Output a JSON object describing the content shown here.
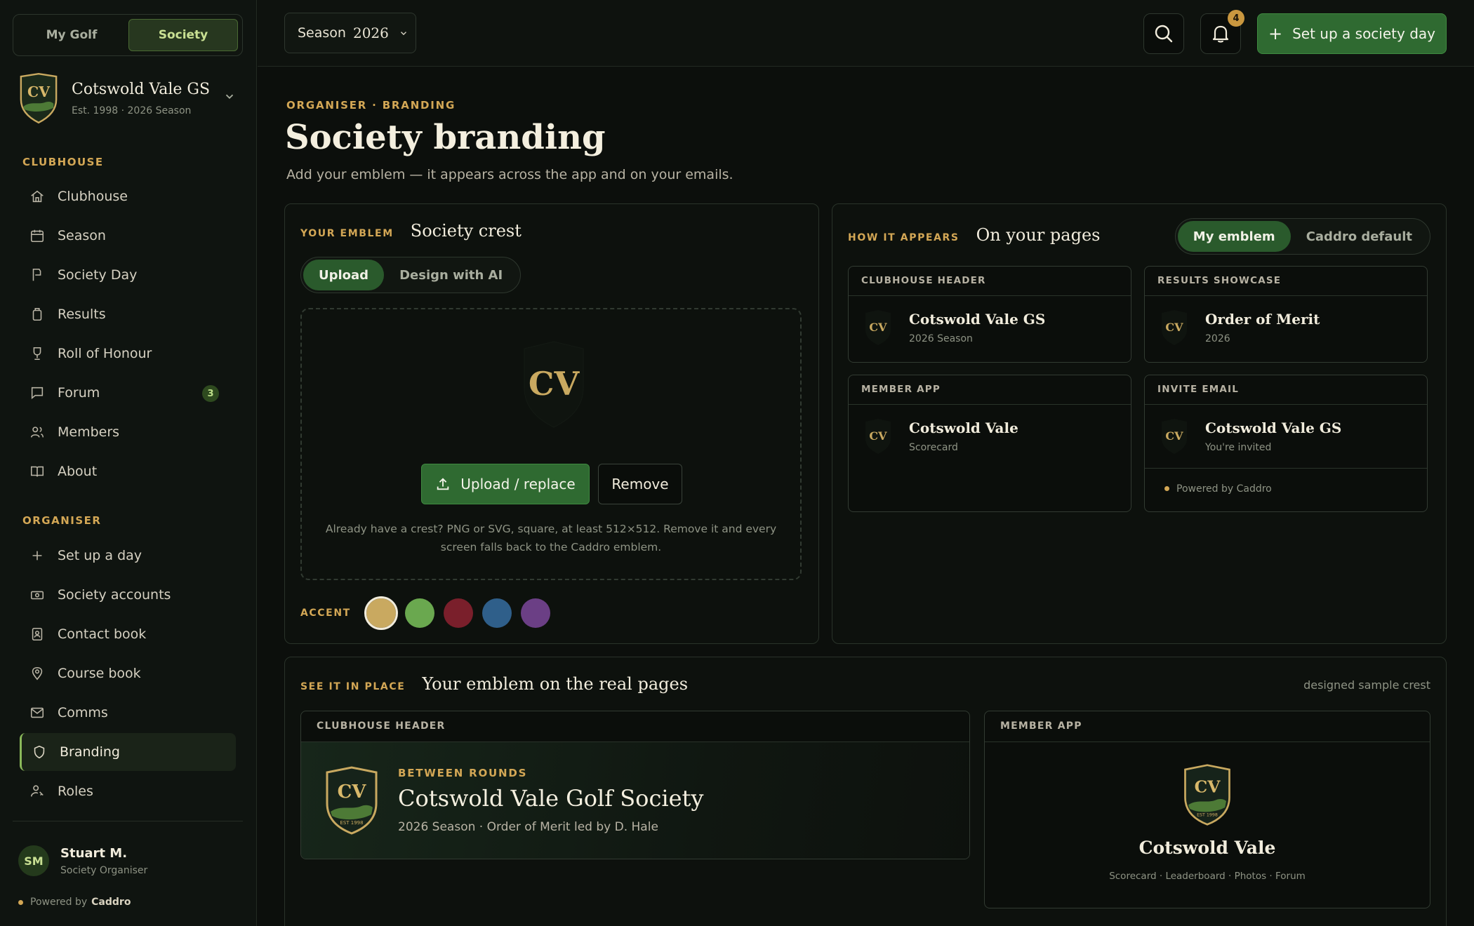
{
  "sidebar": {
    "mode_tabs": [
      "My Golf",
      "Society"
    ],
    "active_mode": "Society",
    "society": {
      "crest_initials": "CV",
      "crest_motto": "EST 1998",
      "name": "Cotswold Vale GS",
      "sub": "Est. 1998 · 2026 Season"
    },
    "sections": {
      "clubhouse": "CLUBHOUSE",
      "organiser": "ORGANISER"
    },
    "clubhouse_items": [
      {
        "label": "Clubhouse",
        "icon": "home-icon"
      },
      {
        "label": "Season",
        "icon": "calendar-icon"
      },
      {
        "label": "Society Day",
        "icon": "flag-icon"
      },
      {
        "label": "Results",
        "icon": "clipboard-icon"
      },
      {
        "label": "Roll of Honour",
        "icon": "trophy-icon"
      },
      {
        "label": "Forum",
        "icon": "chat-icon",
        "badge": "3"
      },
      {
        "label": "Members",
        "icon": "people-icon"
      },
      {
        "label": "About",
        "icon": "book-icon"
      }
    ],
    "organiser_items": [
      {
        "label": "Set up a day",
        "icon": "plus-icon"
      },
      {
        "label": "Society accounts",
        "icon": "money-icon"
      },
      {
        "label": "Contact book",
        "icon": "contact-icon"
      },
      {
        "label": "Course book",
        "icon": "location-pin-icon"
      },
      {
        "label": "Comms",
        "icon": "mail-icon"
      },
      {
        "label": "Branding",
        "icon": "shield-icon",
        "active": true
      },
      {
        "label": "Roles",
        "icon": "user-key-icon"
      }
    ],
    "user": {
      "initials": "SM",
      "name": "Stuart M.",
      "role": "Society Organiser"
    },
    "powered_prefix": "Powered by",
    "powered_brand": "Caddro"
  },
  "topbar": {
    "season_label": "Season",
    "season_year": "2026",
    "notification_count": "4",
    "primary_action": "Set up a society day"
  },
  "page": {
    "eyebrow": "ORGANISER · BRANDING",
    "title": "Society branding",
    "subtitle": "Add your emblem — it appears across the app and on your emails."
  },
  "emblem_panel": {
    "label": "YOUR EMBLEM",
    "heading": "Society crest",
    "tabs": [
      "Upload",
      "Design with AI"
    ],
    "active_tab": "Upload",
    "upload_button": "Upload / replace",
    "remove_button": "Remove",
    "help_text": "Already have a crest? PNG or SVG, square, at least 512×512. Remove it and every screen falls back to the Caddro emblem.",
    "accent_label": "ACCENT",
    "accent_colors": [
      "#c9a960",
      "#6aa84f",
      "#7a1f2b",
      "#2f5f8a",
      "#6b3f85"
    ],
    "accent_selected": "#c9a960"
  },
  "appears_panel": {
    "label": "HOW IT APPEARS",
    "heading": "On your pages",
    "toggle": [
      "My emblem",
      "Caddro default"
    ],
    "active_toggle": "My emblem",
    "cards": [
      {
        "label": "CLUBHOUSE HEADER",
        "title": "Cotswold Vale GS",
        "sub": "2026 Season"
      },
      {
        "label": "RESULTS SHOWCASE",
        "title": "Order of Merit",
        "sub": "2026"
      },
      {
        "label": "MEMBER APP",
        "title": "Cotswold Vale",
        "sub": "Scorecard"
      },
      {
        "label": "INVITE EMAIL",
        "title": "Cotswold Vale GS",
        "sub": "You're invited",
        "footer": "Powered by Caddro"
      }
    ]
  },
  "inplace_panel": {
    "label": "SEE IT IN PLACE",
    "heading": "Your emblem on the real pages",
    "note": "designed sample crest",
    "clubhouse": {
      "label": "CLUBHOUSE HEADER",
      "eyebrow": "BETWEEN ROUNDS",
      "title": "Cotswold Vale Golf Society",
      "sub": "2026 Season · Order of Merit led by D. Hale"
    },
    "member_app": {
      "label": "MEMBER APP",
      "title": "Cotswold Vale",
      "sub": "Scorecard · Leaderboard · Photos · Forum"
    }
  },
  "colors": {
    "accent_gold": "#d3a755",
    "primary_green": "#2f6a31",
    "background": "#0c0f0c"
  }
}
